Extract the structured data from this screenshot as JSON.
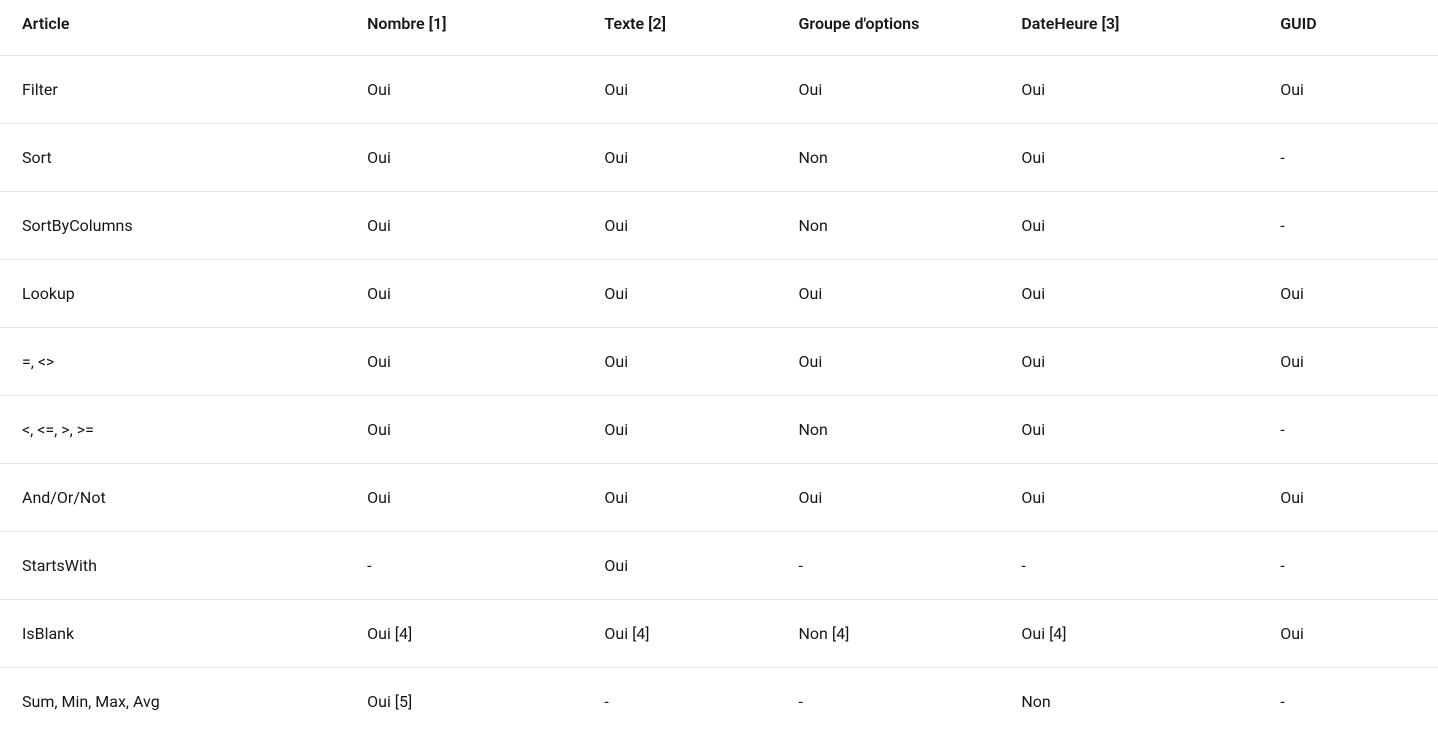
{
  "columns": [
    {
      "key": "article",
      "label": "Article"
    },
    {
      "key": "nombre",
      "label": "Nombre [1]"
    },
    {
      "key": "texte",
      "label": "Texte [2]"
    },
    {
      "key": "groupe",
      "label": "Groupe d'options"
    },
    {
      "key": "dateheure",
      "label": "DateHeure [3]"
    },
    {
      "key": "guid",
      "label": "GUID"
    }
  ],
  "rows": [
    {
      "article": "Filter",
      "nombre": "Oui",
      "texte": "Oui",
      "groupe": "Oui",
      "dateheure": "Oui",
      "guid": "Oui"
    },
    {
      "article": "Sort",
      "nombre": "Oui",
      "texte": "Oui",
      "groupe": "Non",
      "dateheure": "Oui",
      "guid": "-"
    },
    {
      "article": "SortByColumns",
      "nombre": "Oui",
      "texte": "Oui",
      "groupe": "Non",
      "dateheure": "Oui",
      "guid": "-"
    },
    {
      "article": "Lookup",
      "nombre": "Oui",
      "texte": "Oui",
      "groupe": "Oui",
      "dateheure": "Oui",
      "guid": "Oui"
    },
    {
      "article": "=, <>",
      "nombre": "Oui",
      "texte": "Oui",
      "groupe": "Oui",
      "dateheure": "Oui",
      "guid": "Oui"
    },
    {
      "article": "<, <=, >, >=",
      "nombre": "Oui",
      "texte": "Oui",
      "groupe": "Non",
      "dateheure": "Oui",
      "guid": "-"
    },
    {
      "article": "And/Or/Not",
      "nombre": "Oui",
      "texte": "Oui",
      "groupe": "Oui",
      "dateheure": "Oui",
      "guid": "Oui"
    },
    {
      "article": "StartsWith",
      "nombre": "-",
      "texte": "Oui",
      "groupe": "-",
      "dateheure": "-",
      "guid": "-"
    },
    {
      "article": "IsBlank",
      "nombre": "Oui [4]",
      "texte": "Oui [4]",
      "groupe": "Non [4]",
      "dateheure": "Oui [4]",
      "guid": "Oui"
    },
    {
      "article": "Sum, Min, Max, Avg",
      "nombre": "Oui [5]",
      "texte": "-",
      "groupe": "-",
      "dateheure": "Non",
      "guid": "-"
    }
  ]
}
